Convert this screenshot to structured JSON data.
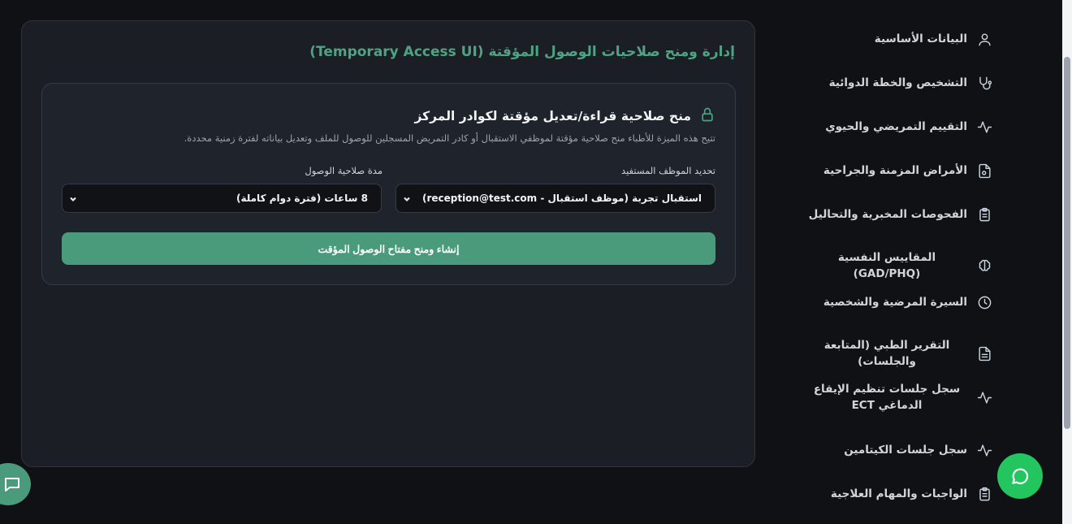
{
  "sidebar": {
    "items": [
      {
        "label": "البيانات الأساسية",
        "icon": "user-icon"
      },
      {
        "label": "التشخيص والخطة الدوائية",
        "icon": "stethoscope-icon"
      },
      {
        "label": "التقييم التمريضي والحيوي",
        "icon": "activity-icon"
      },
      {
        "label": "الأمراض المزمنة والجراحية",
        "icon": "file-medical-icon"
      },
      {
        "label": "الفحوصات المخبرية والتحاليل",
        "icon": "clipboard-icon"
      },
      {
        "label": "المقاييس النفسية (GAD/PHQ)",
        "icon": "brain-icon"
      },
      {
        "label": "السيرة المرضية والشخصية",
        "icon": "clock-icon"
      },
      {
        "label": "التقرير الطبي (المتابعة والجلسات)",
        "icon": "document-icon"
      },
      {
        "label": "سجل جلسات تنظيم الإيقاع الدماغي ECT",
        "icon": "activity-icon"
      },
      {
        "label": "سجل جلسات الكيتامين",
        "icon": "activity-icon"
      },
      {
        "label": "الواجبات والمهام العلاجية",
        "icon": "clipboard-check-icon"
      }
    ]
  },
  "panel": {
    "title": "إدارة ومنح صلاحيات الوصول المؤقتة (Temporary Access UI)",
    "card": {
      "title": "منح صلاحية قراءة/تعديل مؤقتة لكوادر المركز",
      "description": "تتيح هذه الميزة للأطباء منح صلاحية مؤقتة لموظفي الاستقبال أو كادر التمريض المسجلين للوصول للملف وتعديل بياناته لفترة زمنية محددة.",
      "employee_label": "تحديد الموظف المستفيد",
      "employee_value": "استقبال تجربة (موظف استقبال - reception@test.com)",
      "duration_label": "مدة صلاحية الوصول",
      "duration_value": "8 ساعات (فترة دوام كاملة)",
      "submit_label": "إنشاء ومنح مفتاح الوصول المؤقت"
    }
  },
  "colors": {
    "accent": "#4a9a7c",
    "whatsapp": "#22c55e",
    "background": "#0f1114"
  }
}
